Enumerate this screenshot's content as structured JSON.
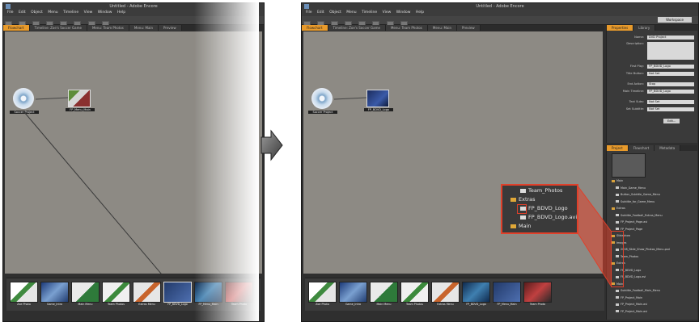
{
  "left": {
    "title": "Untitled - Adobe Encore",
    "menu": [
      "File",
      "Edit",
      "Object",
      "Menu",
      "Timeline",
      "View",
      "Window",
      "Help"
    ],
    "tabs": [
      "Flowchart",
      "Timeline: Zoe's Soccer Game",
      "Menu: Team Photos",
      "Menu: Main",
      "Preview"
    ],
    "nodes": [
      {
        "label": "Soccer Project",
        "kind": "disc"
      },
      {
        "label": "FP_Menu_Main",
        "kind": "menu"
      }
    ],
    "filmstrip": [
      "Zoe Photo",
      "Game_Intro",
      "Main Menu",
      "Team Photos",
      "Extras Menu",
      "FP_BDVD_Logo",
      "FP_Menu_Main",
      "Team Photo"
    ]
  },
  "right": {
    "title": "Untitled - Adobe Encore",
    "menu": [
      "File",
      "Edit",
      "Object",
      "Menu",
      "Timeline",
      "View",
      "Window",
      "Help"
    ],
    "tabs": [
      "Flowchart",
      "Timeline: Zoe's Soccer Game",
      "Menu: Team Photos",
      "Menu: Main",
      "Preview"
    ],
    "workspace_button": "Workspace",
    "nodes": [
      {
        "label": "Soccer Project",
        "kind": "disc"
      },
      {
        "label": "FP_BDVD_Logo",
        "kind": "blue"
      }
    ],
    "properties": {
      "tabs": [
        "Properties",
        "Library"
      ],
      "rows": [
        {
          "k": "Name:",
          "v": "DVD Project"
        },
        {
          "k": "Description:",
          "v": ""
        },
        {
          "k": "First Play:",
          "v": "FP_BDVD_Logo"
        },
        {
          "k": "Title Button:",
          "v": "Not Set"
        },
        {
          "k": "End Action:",
          "v": "Stop"
        },
        {
          "k": "Main Timeline:",
          "v": "FP_BDVD_Logo"
        },
        {
          "k": "Text Subs:",
          "v": "Not Set"
        },
        {
          "k": "Set Subtitle:",
          "v": "Not Set"
        }
      ],
      "button": "Edit..."
    },
    "project": {
      "tabs": [
        "Project",
        "Flowchart",
        "Metadata"
      ],
      "items": [
        {
          "icon": "folder",
          "label": "Main"
        },
        {
          "icon": "file",
          "label": "Main_Game_Menu"
        },
        {
          "icon": "file",
          "label": "Button_Subtitle_Game_Menu"
        },
        {
          "icon": "file",
          "label": "Subtitle_for_Game_Menu"
        },
        {
          "icon": "folder",
          "label": "Extras"
        },
        {
          "icon": "file",
          "label": "Subtitle_Football_Extras_Menu"
        },
        {
          "icon": "file",
          "label": "FP_Project_Page.avi"
        },
        {
          "icon": "file",
          "label": "FP_Project_Page"
        },
        {
          "icon": "folder",
          "label": "Slideshow"
        },
        {
          "icon": "folder",
          "label": "Images"
        },
        {
          "icon": "file",
          "label": "2008_Slide_Show_Photos_Menu.psd"
        },
        {
          "icon": "file",
          "label": "Team_Photos"
        },
        {
          "icon": "folder",
          "label": "Extras"
        },
        {
          "icon": "file",
          "label": "FP_BDVD_Logo"
        },
        {
          "icon": "file",
          "label": "FP_BDVD_Logo.avi"
        },
        {
          "icon": "folder",
          "label": "Main"
        },
        {
          "icon": "file",
          "label": "Subtitle_Football_Main_Menu"
        },
        {
          "icon": "file",
          "label": "FP_Project_Main"
        },
        {
          "icon": "file",
          "label": "FP_Project_Main.avi"
        },
        {
          "icon": "file",
          "label": "FP_Project_Main.avi"
        }
      ]
    },
    "callout": [
      {
        "icon": "file",
        "label": "Team_Photos"
      },
      {
        "icon": "folder",
        "label": "Extras"
      },
      {
        "icon": "file",
        "label": "FP_BDVD_Logo"
      },
      {
        "icon": "file",
        "label": "FP_BDVD_Logo.avi"
      },
      {
        "icon": "folder",
        "label": "Main"
      }
    ],
    "filmstrip": [
      "Zoe Photo",
      "Game_Intro",
      "Main Menu",
      "Team Photos",
      "Extras Menu",
      "FP_BDVD_Logo",
      "FP_Menu_Main",
      "Team Photo"
    ]
  },
  "colors": {
    "highlight": "#e0402a",
    "accent_tab": "#e89a2b"
  }
}
